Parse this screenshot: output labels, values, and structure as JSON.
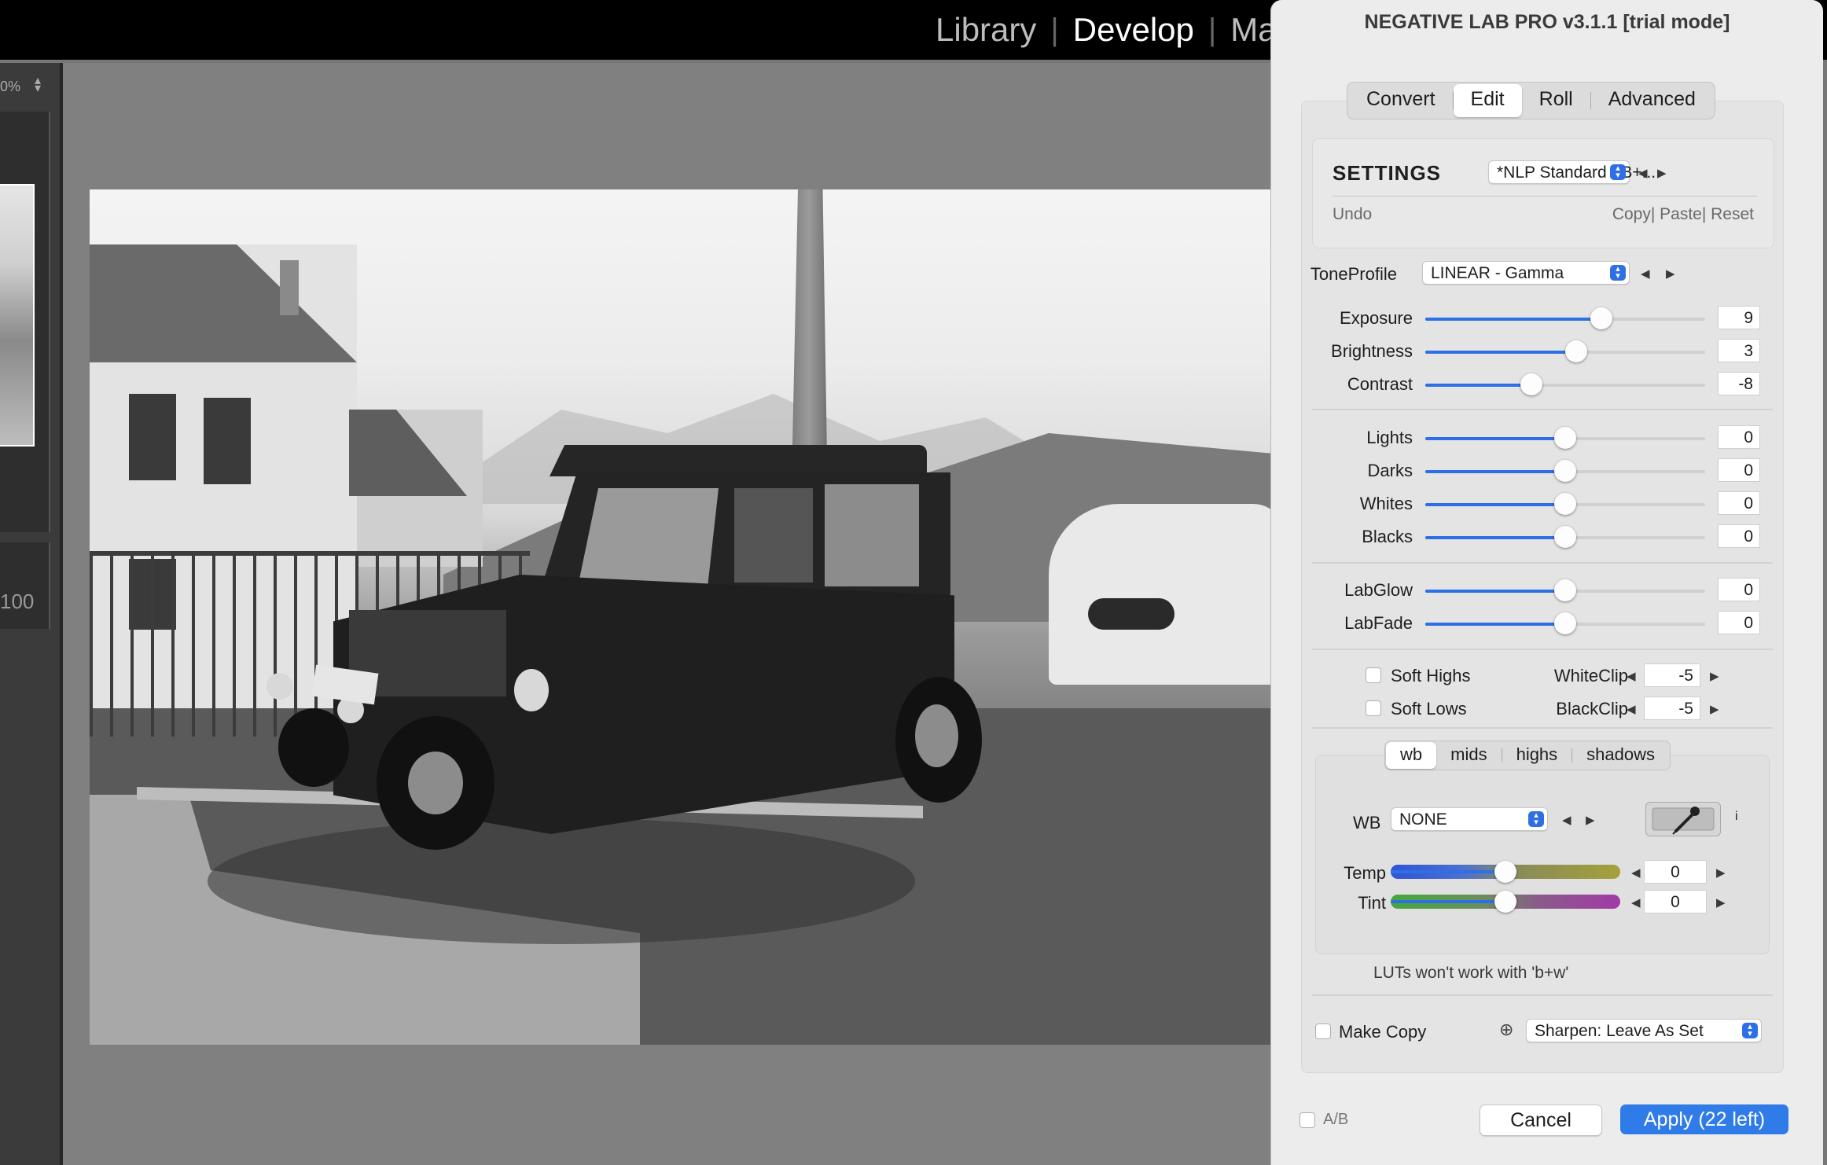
{
  "lightroom": {
    "modules": [
      "Library",
      "Develop",
      "Ma"
    ],
    "zoom_label": "0%",
    "left_value": "100"
  },
  "plugin": {
    "title": "NEGATIVE LAB PRO v3.1.1 [trial mode]",
    "tabs": [
      "Convert",
      "Edit",
      "Roll",
      "Advanced"
    ],
    "selected_tab": "Edit",
    "settings": {
      "heading": "SETTINGS",
      "preset": "*NLP Standard - B+...",
      "undo": "Undo",
      "copy_paste_reset": "Copy| Paste| Reset"
    },
    "tone_profile": {
      "label": "ToneProfile",
      "value": "LINEAR - Gamma"
    },
    "sliders": [
      {
        "label": "Exposure",
        "value": "9",
        "pos": 0.63
      },
      {
        "label": "Brightness",
        "value": "3",
        "pos": 0.54
      },
      {
        "label": "Contrast",
        "value": "-8",
        "pos": 0.38
      },
      {
        "label": "Lights",
        "value": "0",
        "pos": 0.5
      },
      {
        "label": "Darks",
        "value": "0",
        "pos": 0.5
      },
      {
        "label": "Whites",
        "value": "0",
        "pos": 0.5
      },
      {
        "label": "Blacks",
        "value": "0",
        "pos": 0.5
      },
      {
        "label": "LabGlow",
        "value": "0",
        "pos": 0.5
      },
      {
        "label": "LabFade",
        "value": "0",
        "pos": 0.5
      }
    ],
    "soft_highs": "Soft Highs",
    "soft_lows": "Soft Lows",
    "white_clip": {
      "label": "WhiteClip",
      "value": "-5"
    },
    "black_clip": {
      "label": "BlackClip",
      "value": "-5"
    },
    "color_tabs": [
      "wb",
      "mids",
      "highs",
      "shadows"
    ],
    "selected_color_tab": "wb",
    "wb": {
      "label": "WB",
      "value": "NONE"
    },
    "info": "i",
    "temp": {
      "label": "Temp",
      "value": "0",
      "pos": 0.5
    },
    "tint": {
      "label": "Tint",
      "value": "0",
      "pos": 0.5
    },
    "lut_note": "LUTs won't work with 'b+w'",
    "make_copy": "Make Copy",
    "sharpen": "Sharpen: Leave As Set",
    "ab": "A/B",
    "cancel": "Cancel",
    "apply": "Apply (22 left)",
    "colors": {
      "accent": "#2f6fe6",
      "window_bg": "#ececec"
    }
  }
}
